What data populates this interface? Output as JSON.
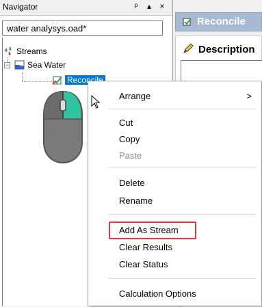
{
  "navigator": {
    "title": "Navigator",
    "controls": {
      "pin": "ᵖ",
      "dropdown": "▴",
      "close": "×"
    },
    "file_tab": "water analysys.oad*",
    "tree": {
      "root_label": "Streams",
      "child_label": "Sea Water",
      "grandchild_label": "Reconcile"
    }
  },
  "right_panel": {
    "tab_title": "Reconcile",
    "description_label": "Description"
  },
  "context_menu": {
    "items": [
      {
        "label": "Arrange",
        "submenu_arrow": ">"
      },
      {
        "label": "Cut"
      },
      {
        "label": "Copy"
      },
      {
        "label": "Paste",
        "disabled": true
      },
      {
        "label": "Delete"
      },
      {
        "label": "Rename"
      },
      {
        "label": "Add As Stream",
        "highlighted": true
      },
      {
        "label": "Clear Results"
      },
      {
        "label": "Clear Status"
      },
      {
        "label": "Calculation Options"
      }
    ]
  },
  "colors": {
    "selection": "#0078d7",
    "highlight_box": "#e0393e",
    "mouse_accent": "#2ec4a0",
    "tab_blue": "#a8b9d4"
  }
}
